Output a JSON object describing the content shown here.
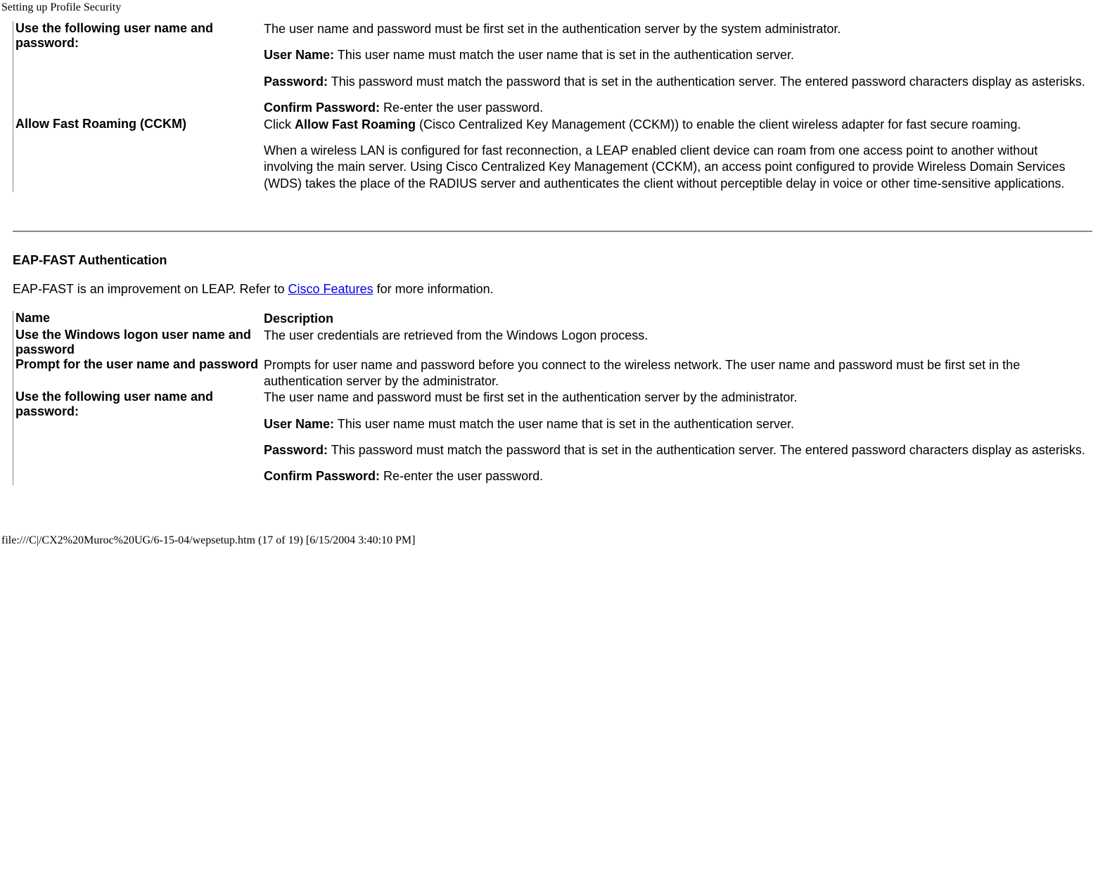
{
  "page_title": "Setting up Profile Security",
  "top_table": {
    "rows": [
      {
        "name": "Use the following user name and password:",
        "desc_parts": [
          {
            "type": "text",
            "text": "The user name and password must be first set in the authentication server by the system administrator."
          },
          {
            "type": "gap"
          },
          {
            "type": "labeled",
            "label": "User Name:",
            "text": " This user name must match the user name that is set in the authentication server."
          },
          {
            "type": "gap"
          },
          {
            "type": "labeled",
            "label": "Password:",
            "text": " This password must match the password that is set in the authentication server. The entered password characters display as asterisks."
          },
          {
            "type": "gap"
          },
          {
            "type": "labeled",
            "label": "Confirm Password:",
            "text": " Re-enter the user password."
          }
        ]
      },
      {
        "name": "Allow Fast Roaming (CCKM)",
        "desc_parts": [
          {
            "type": "mixed",
            "text_before": "Click ",
            "bold": "Allow Fast Roaming",
            "text_after": " (Cisco Centralized Key Management (CCKM)) to enable the client wireless adapter for fast secure roaming."
          },
          {
            "type": "gap"
          },
          {
            "type": "text",
            "text": "When a wireless LAN is configured for fast reconnection, a LEAP enabled client device can roam from one access point to another without involving the main server. Using Cisco Centralized Key Management (CCKM), an access point configured to provide Wireless Domain Services (WDS) takes the place of the RADIUS server and authenticates the client without perceptible delay in voice or other time-sensitive applications."
          }
        ]
      }
    ]
  },
  "section2": {
    "heading": "EAP-FAST Authentication",
    "intro_before": "EAP-FAST is an improvement on LEAP. Refer to ",
    "intro_link": "Cisco Features",
    "intro_after": " for more information.",
    "header_name": "Name",
    "header_desc": "Description",
    "rows": [
      {
        "name": "Use the Windows logon user name and password",
        "desc_parts": [
          {
            "type": "text",
            "text": "The user credentials are retrieved from the Windows Logon process."
          }
        ]
      },
      {
        "name": "Prompt for the user name and password",
        "desc_parts": [
          {
            "type": "text",
            "text": "Prompts for user name and password before you connect to the wireless network. The user name and password must be first set in the authentication server by the administrator."
          }
        ]
      },
      {
        "name": "Use the following user name and password:",
        "desc_parts": [
          {
            "type": "text",
            "text": "The user name and password must be first set in the authentication server by the administrator."
          },
          {
            "type": "gap"
          },
          {
            "type": "labeled",
            "label": "User Name:",
            "text": " This user name must match the user name that is set in the authentication server."
          },
          {
            "type": "gap"
          },
          {
            "type": "labeled",
            "label": "Password:",
            "text": " This password must match the password that is set in the authentication server. The entered password characters display as asterisks."
          },
          {
            "type": "gap"
          },
          {
            "type": "labeled",
            "label": "Confirm Password:",
            "text": " Re-enter the user password."
          }
        ]
      }
    ]
  },
  "footer": "file:///C|/CX2%20Muroc%20UG/6-15-04/wepsetup.htm (17 of 19) [6/15/2004 3:40:10 PM]"
}
